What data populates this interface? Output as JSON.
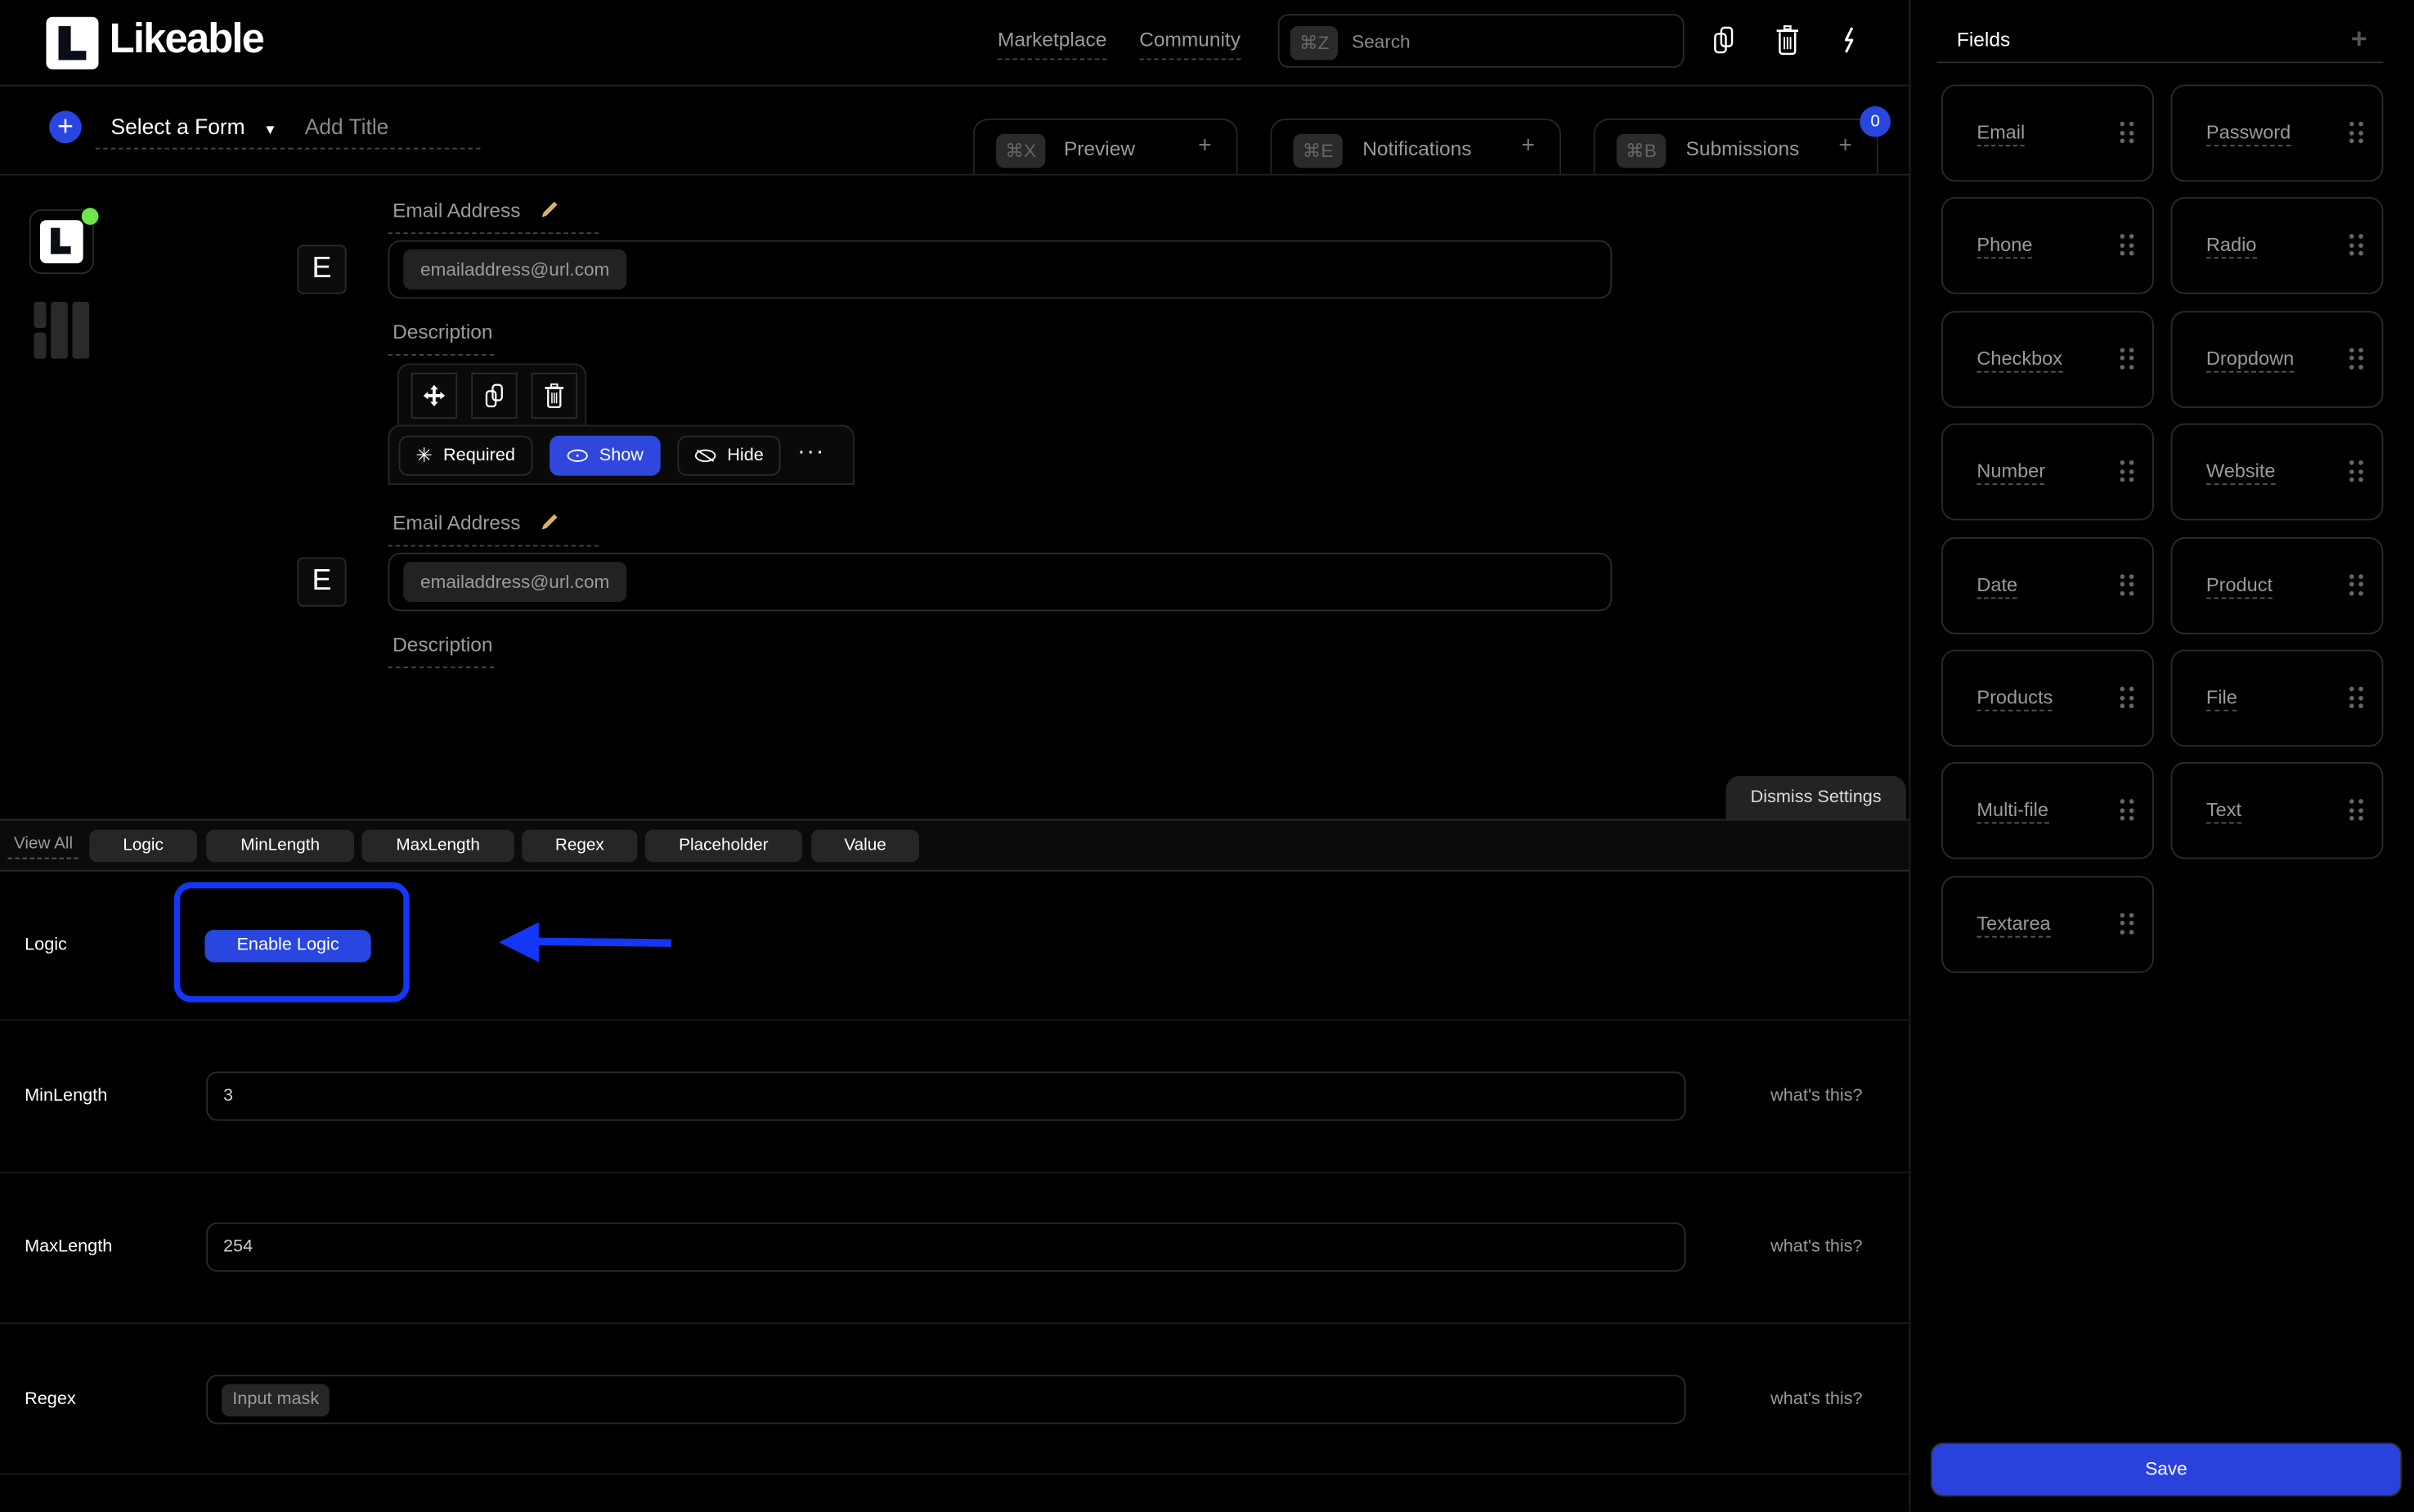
{
  "header": {
    "brand": "Likeable",
    "nav": [
      {
        "label": "Marketplace"
      },
      {
        "label": "Community"
      }
    ],
    "search": {
      "shortcut": "⌘Z",
      "placeholder": "Search"
    },
    "icons": [
      "duplicate-icon",
      "trash-icon",
      "lightning-icon"
    ]
  },
  "toolbar": {
    "add_icon": "+",
    "form_select": "Select a Form",
    "form_select_caret": "▼",
    "title_placeholder": "Add Title",
    "tabs": [
      {
        "shortcut": "⌘X",
        "label": "Preview",
        "plus": "+"
      },
      {
        "shortcut": "⌘E",
        "label": "Notifications",
        "plus": "+"
      },
      {
        "shortcut": "⌘B",
        "label": "Submissions",
        "plus": "+"
      }
    ],
    "submissions_badge": "0"
  },
  "canvas": {
    "fields": [
      {
        "letter": "E",
        "label": "Email Address",
        "placeholder": "emailaddress@url.com",
        "description": "Description"
      },
      {
        "letter": "E",
        "label": "Email Address",
        "placeholder": "emailaddress@url.com",
        "description": "Description"
      }
    ],
    "field_actions": {
      "required": "Required",
      "show": "Show",
      "hide": "Hide",
      "more": "···"
    }
  },
  "settings": {
    "dismiss": "Dismiss Settings",
    "view_all": "View All",
    "filters": [
      "Logic",
      "MinLength",
      "MaxLength",
      "Regex",
      "Placeholder",
      "Value"
    ],
    "rows": {
      "logic": {
        "label": "Logic",
        "button": "Enable Logic"
      },
      "minlength": {
        "label": "MinLength",
        "value": "3",
        "help": "what's this?"
      },
      "maxlength": {
        "label": "MaxLength",
        "value": "254",
        "help": "what's this?"
      },
      "regex": {
        "label": "Regex",
        "chip": "Input mask",
        "help": "what's this?"
      }
    }
  },
  "fields_panel": {
    "title": "Fields",
    "add": "+",
    "items": [
      "Email",
      "Password",
      "Phone",
      "Radio",
      "Checkbox",
      "Dropdown",
      "Number",
      "Website",
      "Date",
      "Product",
      "Products",
      "File",
      "Multi-file",
      "Text",
      "Textarea"
    ],
    "save": "Save"
  },
  "colors": {
    "accent": "#2a46e0",
    "annotation": "#1436f5",
    "status_online": "#6ee64a",
    "pencil": "#d8b46a"
  }
}
